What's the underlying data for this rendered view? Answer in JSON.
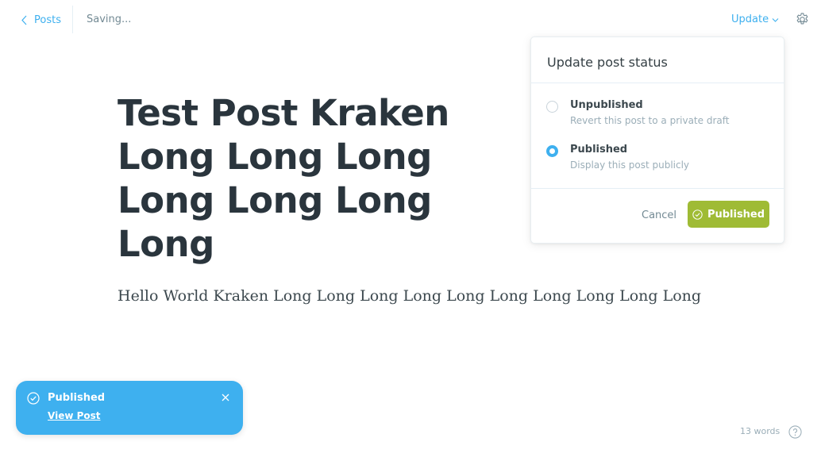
{
  "header": {
    "back_label": "Posts",
    "status": "Saving...",
    "update_label": "Update"
  },
  "editor": {
    "title": "Test Post Kraken Long Long Long Long Long Long Long",
    "body": "Hello World Kraken Long Long Long Long Long Long Long Long Long Long"
  },
  "popover": {
    "title": "Update post status",
    "options": [
      {
        "label": "Unpublished",
        "description": "Revert this post to a private draft",
        "checked": false
      },
      {
        "label": "Published",
        "description": "Display this post publicly",
        "checked": true
      }
    ],
    "cancel_label": "Cancel",
    "confirm_label": "Published"
  },
  "toast": {
    "title": "Published",
    "link_label": "View Post"
  },
  "footer": {
    "word_count": "13 words"
  },
  "colors": {
    "accent_blue": "#3eb0ef",
    "publish_green": "#9fbb35"
  },
  "icons": {
    "back": "chevron-left-icon",
    "update": "chevron-down-icon",
    "settings": "gear-icon",
    "confirm": "check-circle-icon",
    "toast": "check-circle-icon",
    "close": "close-icon",
    "help": "question-circle-icon"
  }
}
